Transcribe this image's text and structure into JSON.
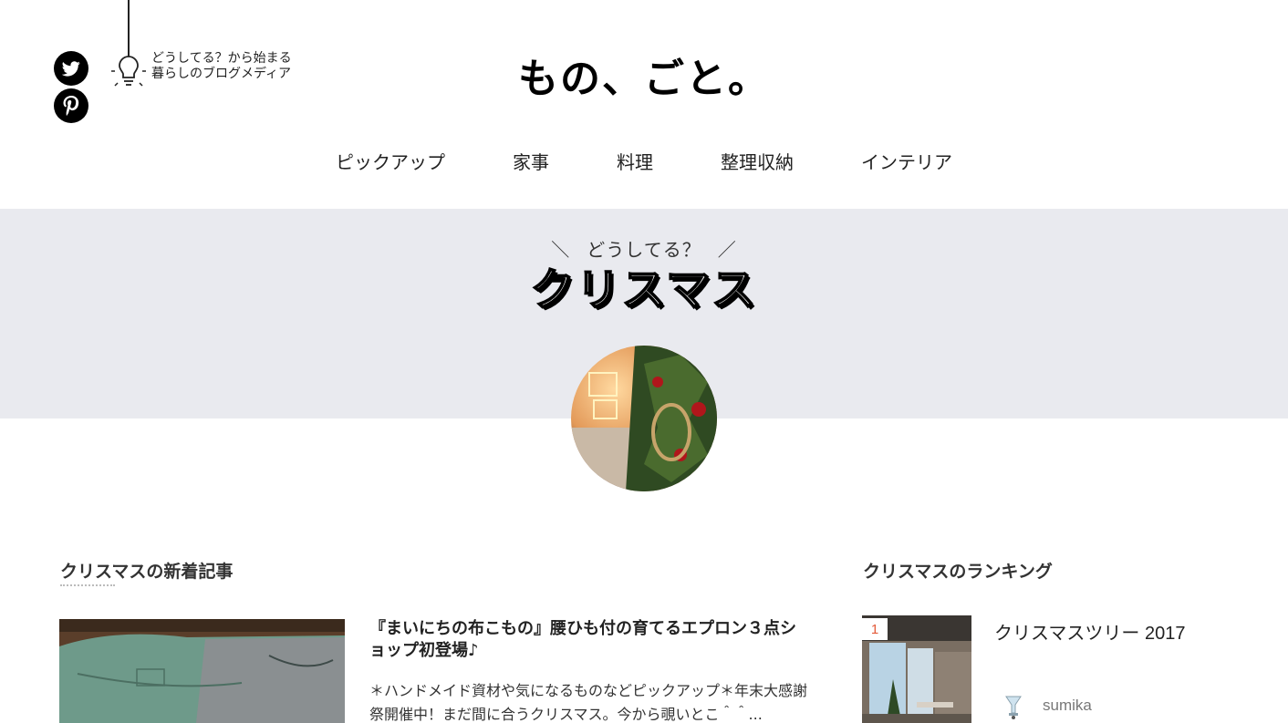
{
  "header": {
    "tagline_line1": "どうしてる？から始まる",
    "tagline_line2": "暮らしのブログメディア",
    "logo_text": "もの、ごと。",
    "social": [
      {
        "name": "twitter-icon"
      },
      {
        "name": "pinterest-icon"
      }
    ]
  },
  "nav": {
    "items": [
      {
        "label": "ピックアップ"
      },
      {
        "label": "家事"
      },
      {
        "label": "料理"
      },
      {
        "label": "整理収納"
      },
      {
        "label": "インテリア"
      }
    ]
  },
  "hero": {
    "subtitle": "どうしてる？",
    "title": "クリスマス"
  },
  "latest": {
    "heading": "クリスマスの新着記事",
    "article": {
      "title": "『まいにちの布こもの』腰ひも付の育てるエプロン３点ショップ初登場♪",
      "excerpt": "＊ハンドメイド資材や気になるものなどピックアップ＊年末大感謝祭開催中！まだ間に合うクリスマス。今から覗いとこ＾＾..."
    }
  },
  "ranking": {
    "heading": "クリスマスのランキング",
    "items": [
      {
        "rank": "1",
        "title": "クリスマスツリー 2017",
        "author": "sumika"
      }
    ]
  },
  "colors": {
    "hero_band": "#e9eaef",
    "rank_number": "#e35b3a",
    "icon_bg": "#000000"
  }
}
